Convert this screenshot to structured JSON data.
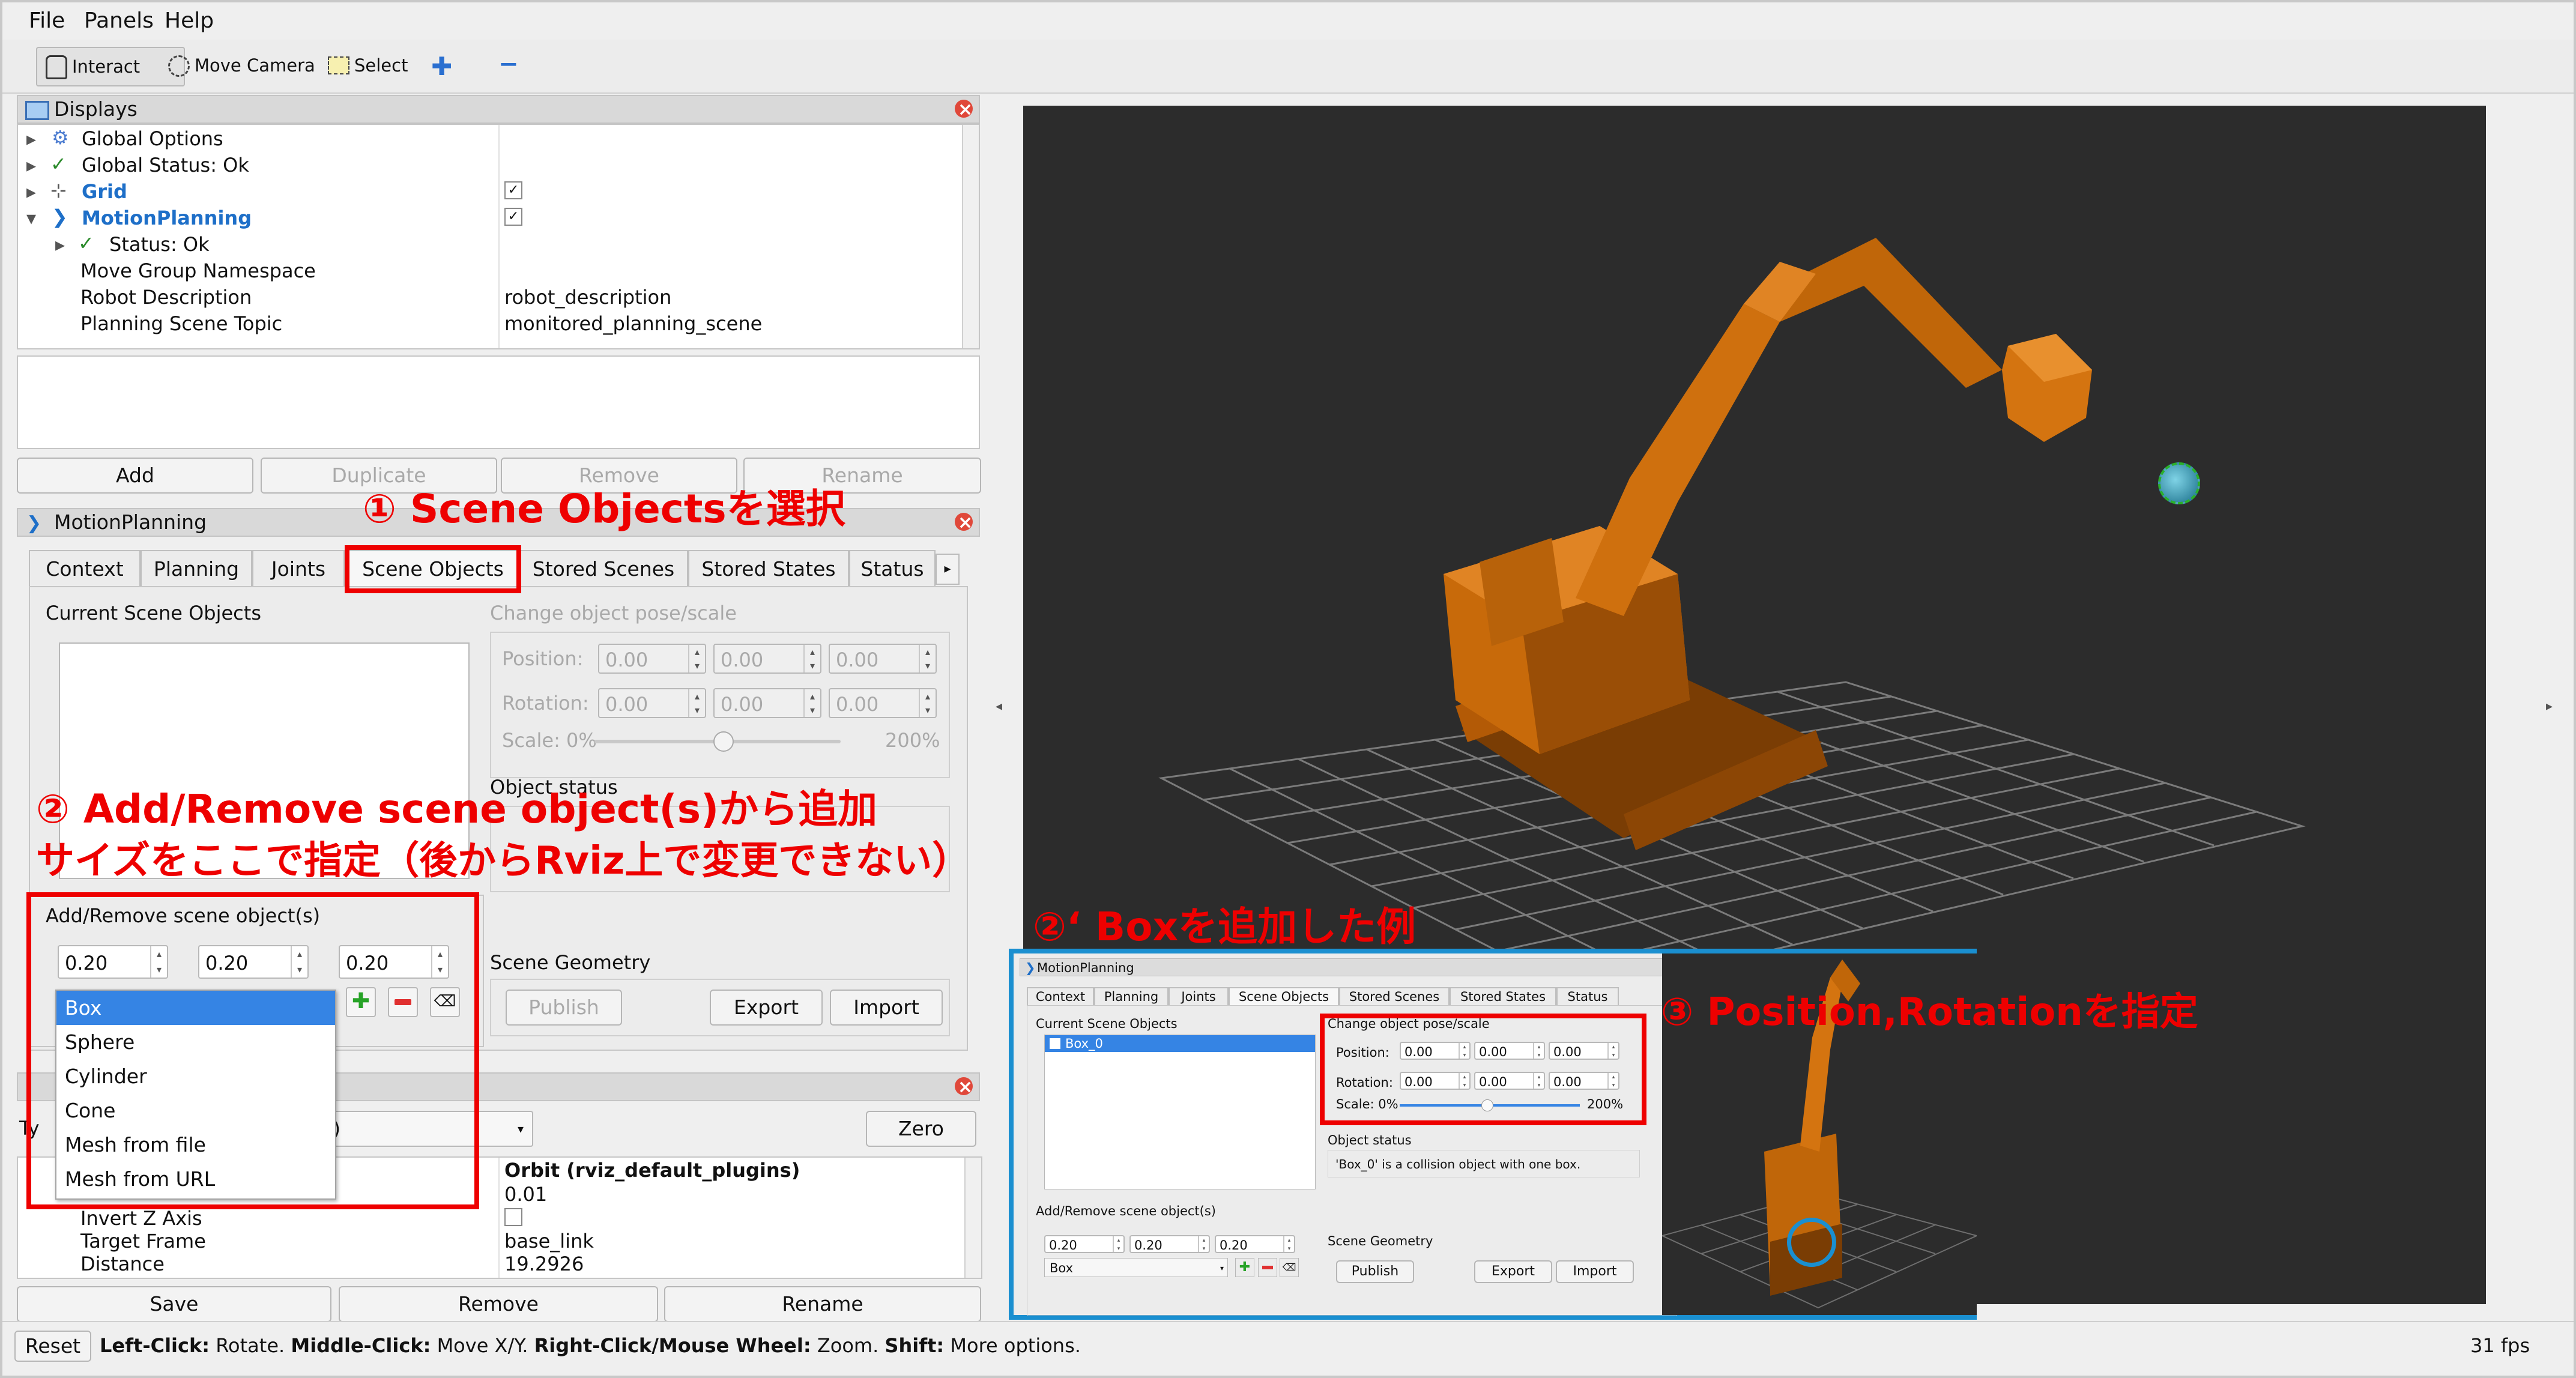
{
  "menu": {
    "file": "File",
    "panels": "Panels",
    "help": "Help"
  },
  "toolbar": {
    "interact": "Interact",
    "move_camera": "Move Camera",
    "select": "Select"
  },
  "displays": {
    "title": "Displays",
    "rows": [
      {
        "label": "Global Options",
        "value": ""
      },
      {
        "label": "Global Status: Ok",
        "value": ""
      },
      {
        "label": "Grid",
        "value": ""
      },
      {
        "label": "MotionPlanning",
        "value": ""
      },
      {
        "label": "Status: Ok",
        "value": ""
      },
      {
        "label": "Move Group Namespace",
        "value": ""
      },
      {
        "label": "Robot Description",
        "value": "robot_description"
      },
      {
        "label": "Planning Scene Topic",
        "value": "monitored_planning_scene"
      }
    ],
    "buttons": {
      "add": "Add",
      "duplicate": "Duplicate",
      "remove": "Remove",
      "rename": "Rename"
    }
  },
  "motion": {
    "title": "MotionPlanning",
    "tabs": [
      "Context",
      "Planning",
      "Joints",
      "Scene Objects",
      "Stored Scenes",
      "Stored States",
      "Status"
    ],
    "current_scene_objects": "Current Scene Objects",
    "change_pose": "Change object pose/scale",
    "position_label": "Position:",
    "rotation_label": "Rotation:",
    "scale_label": "Scale: 0%",
    "scale_max": "200%",
    "zero": "0.00",
    "object_status": "Object status",
    "add_remove": "Add/Remove scene object(s)",
    "size_x": "0.20",
    "size_y": "0.20",
    "size_z": "0.20",
    "scene_geometry": "Scene Geometry",
    "publish": "Publish",
    "export": "Export",
    "import": "Import",
    "dropdown": [
      "Box",
      "Sphere",
      "Cylinder",
      "Cone",
      "Mesh from file",
      "Mesh from URL"
    ]
  },
  "views": {
    "type_fragment": "Ty",
    "type_value_fragment": "))",
    "zero_btn": "Zero",
    "rows": [
      {
        "label": "Invert Z Axis",
        "value": "Orbit (rviz_default_plugins)"
      },
      {
        "label": "Target Frame",
        "value": "base_link"
      },
      {
        "label": "Distance",
        "value": "19.2926"
      }
    ],
    "near_clip_value": "0.01",
    "buttons": {
      "save": "Save",
      "remove": "Remove",
      "rename": "Rename"
    }
  },
  "status_bar": {
    "reset": "Reset",
    "hint_parts": [
      {
        "b": "Left-Click:",
        "t": " Rotate. "
      },
      {
        "b": "Middle-Click:",
        "t": " Move X/Y. "
      },
      {
        "b": "Right-Click/Mouse Wheel:",
        "t": " Zoom. "
      },
      {
        "b": "Shift:",
        "t": " More options."
      }
    ],
    "fps": "31 fps"
  },
  "annotations": {
    "a1": "① Scene Objectsを選択",
    "a2_line1": "② Add/Remove scene object(s)から追加",
    "a2_line2": "サイズをここで指定（後からRviz上で変更できない）",
    "a2b": "②‘ Boxを追加した例",
    "a3": "③ Position,Rotationを指定"
  },
  "inset": {
    "title": "MotionPlanning",
    "tabs": [
      "Context",
      "Planning",
      "Joints",
      "Scene Objects",
      "Stored Scenes",
      "Stored States",
      "Status"
    ],
    "current_scene_objects": "Current Scene Objects",
    "object_item": "Box_0",
    "change_pose": "Change object pose/scale",
    "position_label": "Position:",
    "rotation_label": "Rotation:",
    "scale_label": "Scale: 0%",
    "scale_max": "200%",
    "zero": "0.00",
    "object_status": "Object status",
    "status_text": "'Box_0' is a collision object with one box.",
    "add_remove": "Add/Remove scene object(s)",
    "size_x": "0.20",
    "size_y": "0.20",
    "size_z": "0.20",
    "shape": "Box",
    "scene_geometry": "Scene Geometry",
    "publish": "Publish",
    "export": "Export",
    "import": "Import"
  },
  "colors": {
    "accent_red": "#ee0000",
    "inset_border": "#1a8fd0",
    "robot": "#c86a0a",
    "viewport_bg": "#2c2c2c",
    "link_blue": "#1e6fc8"
  }
}
